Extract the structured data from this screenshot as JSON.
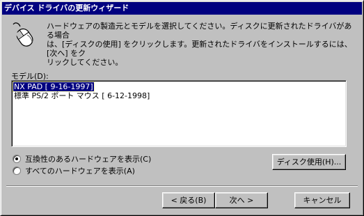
{
  "window": {
    "title": "デバイス ドライバの更新ウィザード"
  },
  "instructions": {
    "line1": "ハードウェアの製造元とモデルを選択してください。ディスクに更新されたドライバがある場合",
    "line2": "は、[ディスクの使用] をクリックします。更新されたドライバをインストールするには、[次へ] をク",
    "line3": "リックしてください。"
  },
  "icons": {
    "wizard": "mouse-icon"
  },
  "model_list": {
    "label": "モデル(D):",
    "items": [
      {
        "label": "NX PAD [ 9-16-1997]",
        "selected": true
      },
      {
        "label": "標準 PS/2 ポート マウス [ 6-12-1998]",
        "selected": false
      }
    ]
  },
  "options": {
    "show_compatible": {
      "label": "互換性のあるハードウェアを表示(C)",
      "checked": true
    },
    "show_all": {
      "label": "すべてのハードウェアを表示(A)",
      "checked": false
    }
  },
  "buttons": {
    "have_disk": "ディスク使用(H)...",
    "back": "< 戻る(B)",
    "next": "次へ >",
    "cancel": "キャンセル"
  },
  "colors": {
    "face": "#c0c0c0",
    "titlebar": "#000080",
    "selection": "#000080"
  }
}
